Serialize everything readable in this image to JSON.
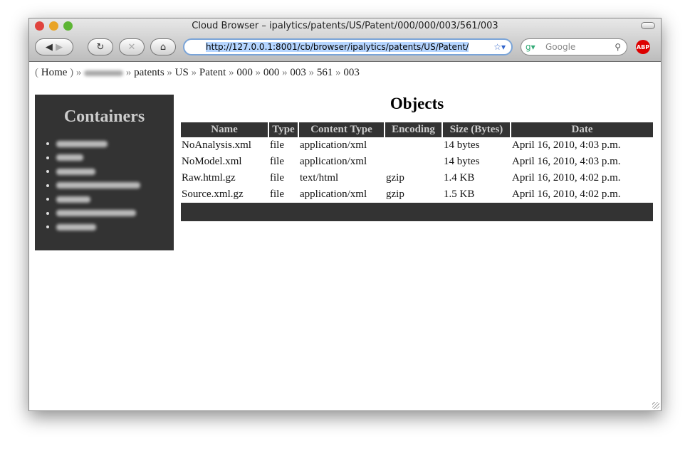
{
  "window": {
    "title": "Cloud Browser – ipalytics/patents/US/Patent/000/000/003/561/003"
  },
  "toolbar": {
    "url": "http://127.0.0.1:8001/cb/browser/ipalytics/patents/US/Patent/",
    "search_placeholder": "Google",
    "abp": "ABP"
  },
  "breadcrumb": {
    "home": "Home",
    "items": [
      "patents",
      "US",
      "Patent",
      "000",
      "000",
      "003",
      "561",
      "003"
    ]
  },
  "sidebar": {
    "title": "Containers"
  },
  "main": {
    "title": "Objects",
    "columns": [
      "Name",
      "Type",
      "Content Type",
      "Encoding",
      "Size (Bytes)",
      "Date"
    ],
    "rows": [
      [
        "NoAnalysis.xml",
        "file",
        "application/xml",
        "",
        "14 bytes",
        "April 16, 2010, 4:03 p.m."
      ],
      [
        "NoModel.xml",
        "file",
        "application/xml",
        "",
        "14 bytes",
        "April 16, 2010, 4:03 p.m."
      ],
      [
        "Raw.html.gz",
        "file",
        "text/html",
        "gzip",
        "1.4 KB",
        "April 16, 2010, 4:02 p.m."
      ],
      [
        "Source.xml.gz",
        "file",
        "application/xml",
        "gzip",
        "1.5 KB",
        "April 16, 2010, 4:02 p.m."
      ]
    ]
  }
}
